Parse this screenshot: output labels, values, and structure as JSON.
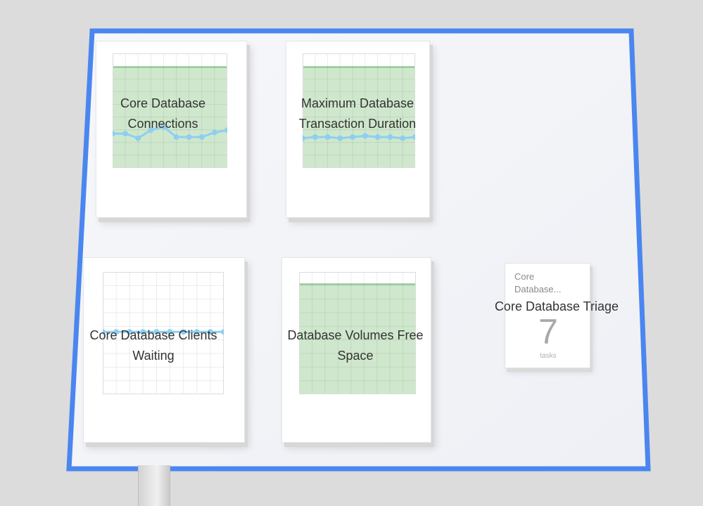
{
  "dashboard": {
    "accent": "#4a86f0",
    "charts": [
      {
        "id": "connections",
        "title": "Core Database Connections",
        "band": true,
        "series_color": "#8ecff0",
        "band_color": "#cfe8cd",
        "line_color": "#88c58a",
        "band_level": 0.88,
        "values": [
          0.3,
          0.3,
          0.26,
          0.33,
          0.36,
          0.27,
          0.27,
          0.27,
          0.31,
          0.33
        ]
      },
      {
        "id": "transaction",
        "title": "Maximum Database Transaction Duration",
        "band": true,
        "series_color": "#8ecff0",
        "band_color": "#cfe8cd",
        "line_color": "#88c58a",
        "band_level": 0.88,
        "values": [
          0.26,
          0.27,
          0.27,
          0.26,
          0.27,
          0.28,
          0.27,
          0.27,
          0.26,
          0.27
        ]
      },
      {
        "id": "waiting",
        "title": "Core Database Clients Waiting",
        "band": false,
        "series_color": "#8ecff0",
        "values": [
          0.51,
          0.51,
          0.51,
          0.51,
          0.51,
          0.51,
          0.51,
          0.51,
          0.51,
          0.51
        ]
      },
      {
        "id": "volumes",
        "title": "Database Volumes Free Space",
        "band": true,
        "series_color": "#8ecff0",
        "band_color": "#cfe8cd",
        "line_color": "#88c58a",
        "band_level": 0.9,
        "values": []
      }
    ],
    "triage": {
      "title": "Core Database Triage",
      "small_label": "Core Database...",
      "count": "7",
      "unit": "tasks"
    }
  }
}
